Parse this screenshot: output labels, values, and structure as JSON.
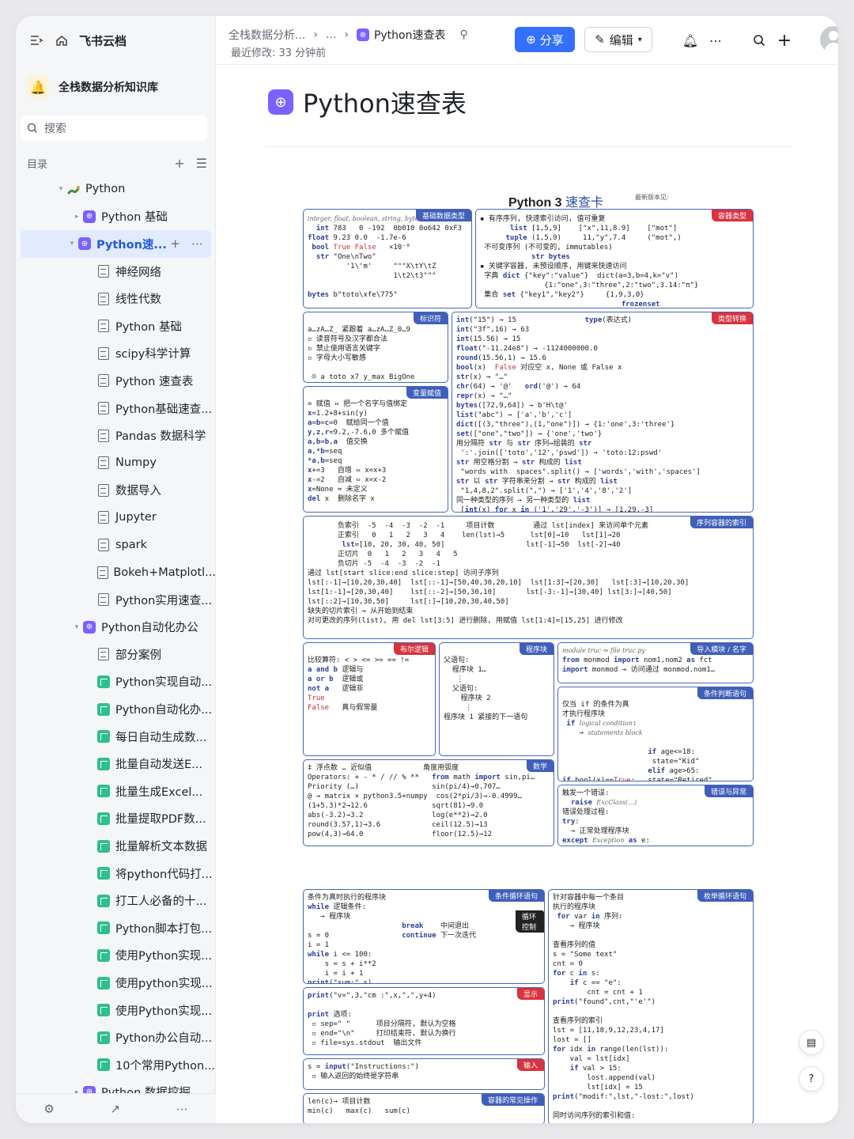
{
  "app": {
    "brand": "飞书云档"
  },
  "knowledge_base": {
    "name": "全栈数据分析知识库"
  },
  "search": {
    "placeholder": "搜索"
  },
  "toc": {
    "title": "目录",
    "items": [
      {
        "label": "Python",
        "level": 0,
        "icon": "snake-icon",
        "arrow": "expanded"
      },
      {
        "label": "Python 基础",
        "level": 1,
        "icon": "python-page-icon",
        "arrow": "collapsed"
      },
      {
        "label": "Python速...",
        "level": 1,
        "icon": "python-page-icon",
        "arrow": "expanded",
        "selected": true
      },
      {
        "label": "神经网络",
        "level": 2,
        "icon": "doc-icon"
      },
      {
        "label": "线性代数",
        "level": 2,
        "icon": "doc-icon"
      },
      {
        "label": "Python 基础",
        "level": 2,
        "icon": "doc-icon"
      },
      {
        "label": "scipy科学计算",
        "level": 2,
        "icon": "doc-icon"
      },
      {
        "label": "Python 速查表",
        "level": 2,
        "icon": "doc-icon"
      },
      {
        "label": "Python基础速查...",
        "level": 2,
        "icon": "doc-icon"
      },
      {
        "label": "Pandas 数据科学",
        "level": 2,
        "icon": "doc-icon"
      },
      {
        "label": "Numpy",
        "level": 2,
        "icon": "doc-icon"
      },
      {
        "label": "数据导入",
        "level": 2,
        "icon": "doc-icon"
      },
      {
        "label": "Jupyter",
        "level": 2,
        "icon": "doc-icon"
      },
      {
        "label": "spark",
        "level": 2,
        "icon": "doc-icon"
      },
      {
        "label": "Bokeh+Matplotl...",
        "level": 2,
        "icon": "doc-icon"
      },
      {
        "label": "Python实用速查...",
        "level": 2,
        "icon": "file-icon"
      },
      {
        "label": "Python自动化办公",
        "level": 1,
        "icon": "python-page-icon",
        "arrow": "expanded"
      },
      {
        "label": "部分案例",
        "level": 2,
        "icon": "file-icon"
      },
      {
        "label": "Python实现自动...",
        "level": 2,
        "icon": "sheet-icon"
      },
      {
        "label": "Python自动化办...",
        "level": 2,
        "icon": "sheet-icon"
      },
      {
        "label": "每日自动生成数...",
        "level": 2,
        "icon": "sheet-icon"
      },
      {
        "label": "批量自动发送E...",
        "level": 2,
        "icon": "sheet-icon"
      },
      {
        "label": "批量生成Excel...",
        "level": 2,
        "icon": "sheet-icon"
      },
      {
        "label": "批量提取PDF数...",
        "level": 2,
        "icon": "sheet-icon"
      },
      {
        "label": "批量解析文本数据",
        "level": 2,
        "icon": "sheet-icon"
      },
      {
        "label": "将python代码打...",
        "level": 2,
        "icon": "sheet-icon"
      },
      {
        "label": "打工人必备的十...",
        "level": 2,
        "icon": "sheet-icon"
      },
      {
        "label": "Python脚本打包...",
        "level": 2,
        "icon": "sheet-icon"
      },
      {
        "label": "使用Python实现...",
        "level": 2,
        "icon": "sheet-icon"
      },
      {
        "label": "使用python实现...",
        "level": 2,
        "icon": "sheet-icon"
      },
      {
        "label": "使用Python实现...",
        "level": 2,
        "icon": "sheet-icon"
      },
      {
        "label": "Python办公自动...",
        "level": 2,
        "icon": "sheet-icon"
      },
      {
        "label": "10个常用Python...",
        "level": 2,
        "icon": "sheet-icon"
      },
      {
        "label": "Python 数据挖掘",
        "level": 1,
        "icon": "python-page-icon",
        "arrow": "collapsed"
      }
    ]
  },
  "topbar": {
    "breadcrumb_parent": "全栈数据分析...",
    "breadcrumb_ellipsis": "...",
    "breadcrumb_current": "Python速查表",
    "last_modified": "最近修改: 33 分钟前",
    "share_label": "分享",
    "edit_label": "编辑"
  },
  "document": {
    "title": "Python速查表",
    "sheet_title_a": "Python 3",
    "sheet_title_b": "速查卡",
    "sheet_version": "最新版本见:",
    "sections": {
      "basic_types": "基础数据类型",
      "container_types": "容器类型",
      "identifiers": "标识符",
      "type_conversion": "类型转换",
      "variable_assignment": "变量赋值",
      "sequence_index": "序列容器的索引",
      "boolean_logic": "布尔逻辑",
      "statement_block": "程序块",
      "import_module": "导入模块 / 名字",
      "conditional": "条件判断语句",
      "math": "数学",
      "exceptions": "错误与异常",
      "while_loop": "条件循环语句",
      "loop_control": "循环控制",
      "for_loop": "枚举循环语句",
      "display": "显示",
      "input": "输入",
      "container_ops": "容器的常见操作"
    }
  },
  "colors": {
    "accent": "#3370ff",
    "sheet_blue": "#3f5fba",
    "sheet_red": "#d9333f",
    "sidebar_bg": "#f5f6f7",
    "selected_bg": "#e1eaff"
  }
}
